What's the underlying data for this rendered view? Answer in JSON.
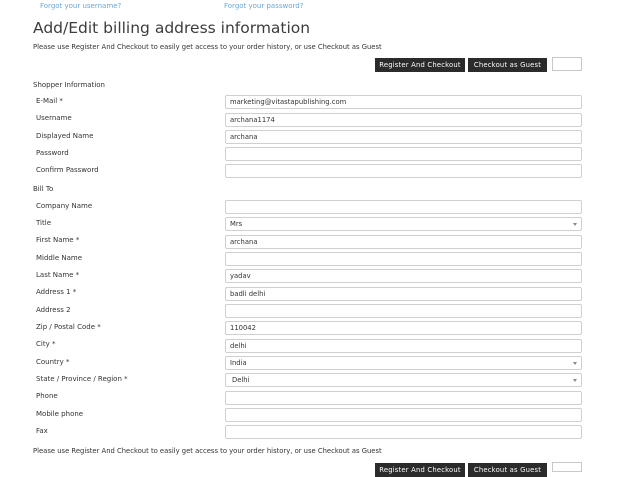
{
  "top_links": {
    "forgot_username": "Forgot your username?",
    "forgot_password": "Forgot your password?"
  },
  "page_title": "Add/Edit billing address information",
  "note": "Please use Register And Checkout to easily get access to your order history, or use Checkout as Guest",
  "buttons": {
    "register_checkout": "Register And Checkout",
    "checkout_guest": "Checkout as Guest"
  },
  "sections": {
    "shopper": "Shopper Information",
    "bill_to": "Bill To"
  },
  "shopper_fields": [
    {
      "label": "E-Mail *",
      "value": "marketing@vitastapublishing.com"
    },
    {
      "label": "Username",
      "value": "archana1174"
    },
    {
      "label": "Displayed Name",
      "value": "archana"
    },
    {
      "label": "Password",
      "value": ""
    },
    {
      "label": "Confirm Password",
      "value": ""
    }
  ],
  "billto_fields": [
    {
      "label": "Company Name",
      "value": ""
    },
    {
      "label": "Title",
      "value": "Mrs"
    },
    {
      "label": "First Name *",
      "value": "archana"
    },
    {
      "label": "Middle Name",
      "value": ""
    },
    {
      "label": "Last Name *",
      "value": "yadav"
    },
    {
      "label": "Address 1 *",
      "value": "badli delhi"
    },
    {
      "label": "Address 2",
      "value": ""
    },
    {
      "label": "Zip / Postal Code *",
      "value": "110042"
    },
    {
      "label": "City *",
      "value": "delhi"
    },
    {
      "label": "Country *",
      "value": "India"
    },
    {
      "label": "State / Province / Region *",
      "value": "Delhi"
    },
    {
      "label": "Phone",
      "value": ""
    },
    {
      "label": "Mobile phone",
      "value": ""
    },
    {
      "label": "Fax",
      "value": ""
    }
  ]
}
